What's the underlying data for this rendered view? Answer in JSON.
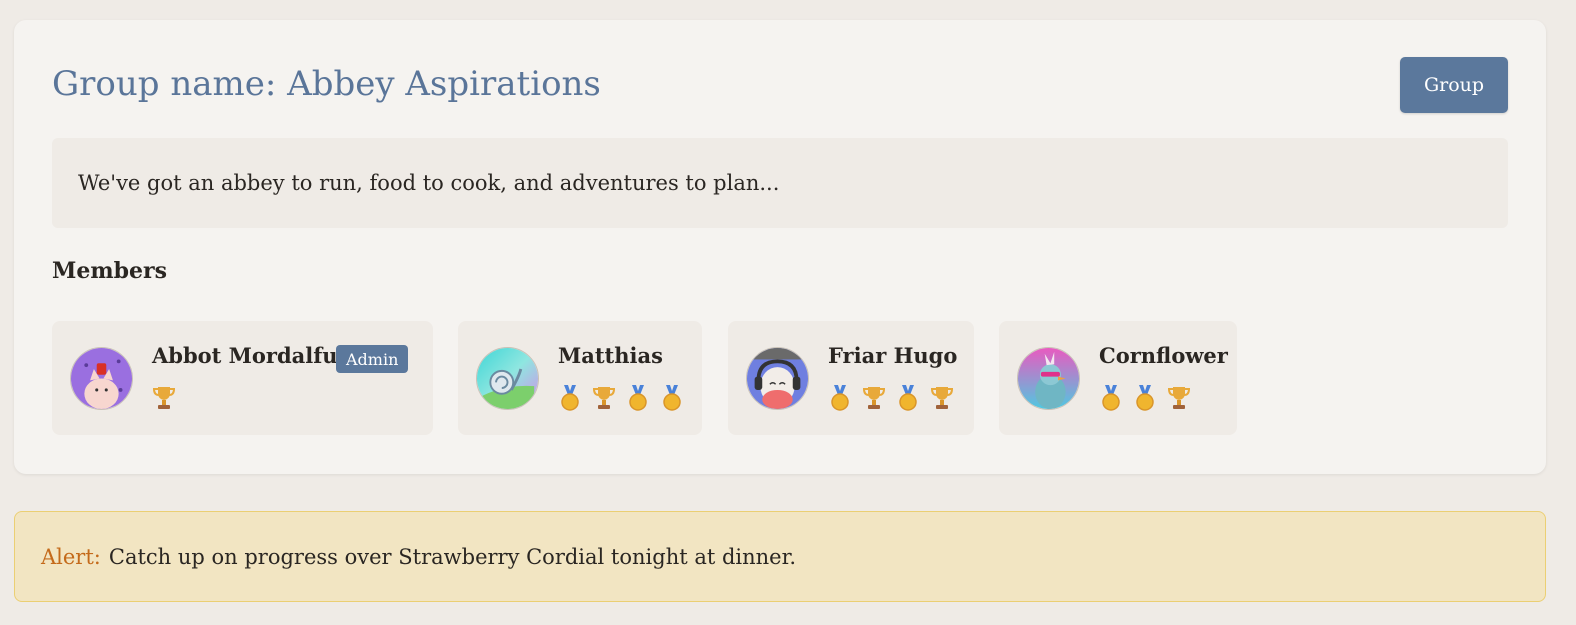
{
  "group": {
    "title": "Group name: Abbey Aspirations",
    "button_label": "Group",
    "description": "We've got an abbey to run, food to cook, and adventures to plan..."
  },
  "members_heading": "Members",
  "members": [
    {
      "name": "Abbot Mordalfus",
      "badge": "Admin",
      "awards": [
        "trophy-icon"
      ]
    },
    {
      "name": "Matthias",
      "awards": [
        "medal-icon",
        "trophy-icon",
        "medal-icon",
        "medal-icon"
      ]
    },
    {
      "name": "Friar Hugo",
      "awards": [
        "medal-icon",
        "trophy-icon",
        "medal-icon",
        "trophy-icon"
      ]
    },
    {
      "name": "Cornflower",
      "awards": [
        "medal-icon",
        "medal-icon",
        "trophy-icon"
      ]
    }
  ],
  "alert": {
    "label": "Alert:",
    "text": "Catch up on progress over Strawberry Cordial tonight at dinner."
  },
  "colors": {
    "accent": "#5b789c",
    "title": "#5a7599",
    "alert_bg": "#f2e5c2",
    "alert_label": "#c46a1a"
  }
}
